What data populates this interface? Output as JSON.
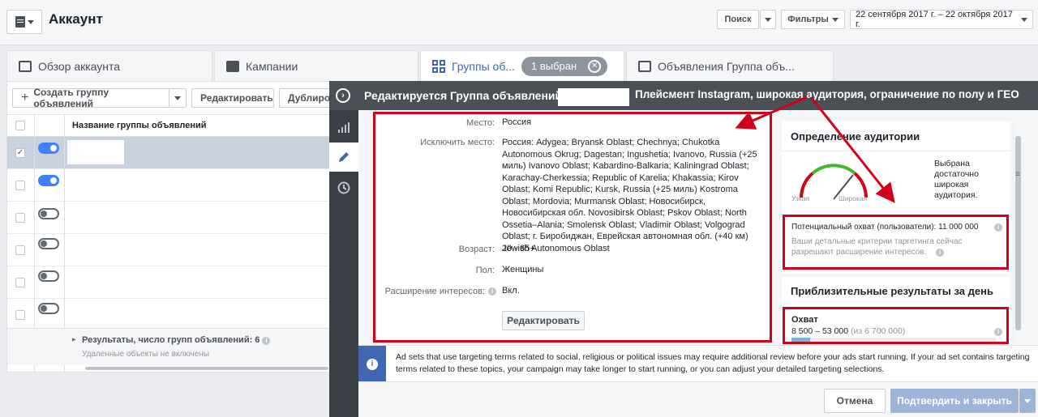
{
  "header": {
    "title": "Аккаунт",
    "search_label": "Поиск",
    "filters_label": "Фильтры",
    "date_range": "22 сентября 2017 г. – 22 октября 2017 г."
  },
  "tabs": [
    {
      "label": "Обзор аккаунта"
    },
    {
      "label": "Кампании"
    },
    {
      "label": "Группы об...",
      "pill": "1 выбран"
    },
    {
      "label": "Объявления Группа объ..."
    }
  ],
  "toolbar": {
    "create_label": "Создать группу объявлений",
    "edit_label": "Редактировать",
    "duplicate_label": "Дублиров"
  },
  "table": {
    "column_name": "Название группы объявлений",
    "footer_title": "Результаты, число групп объявлений: 6",
    "footer_sub": "Удаленные объекты не включены",
    "rows": [
      {
        "selected": true,
        "on": true
      },
      {
        "selected": false,
        "on": true
      },
      {
        "selected": false,
        "on": false
      },
      {
        "selected": false,
        "on": false
      },
      {
        "selected": false,
        "on": false
      },
      {
        "selected": false,
        "on": false
      }
    ]
  },
  "panel": {
    "title": "Редактируется Группа объявлений",
    "annotation": "Плейсмент Instagram, широкая аудитория, ограничение по полу и ГЕО"
  },
  "targeting": {
    "place_label": "Место:",
    "place_value": "Россия",
    "exclude_label": "Исключить место:",
    "exclude_value": "Россия: Adygea; Bryansk Oblast; Chechnya; Chukotka Autonomous Okrug; Dagestan; Ingushetia; Ivanovo, Russia (+25 миль) Ivanovo Oblast; Kabardino-Balkaria; Kaliningrad Oblast; Karachay-Cherkessia; Republic of Karelia; Khakassia; Kirov Oblast; Komi Republic; Kursk, Russia (+25 миль) Kostroma Oblast; Mordovia; Murmansk Oblast; Новосибирск, Новосибирская обл. Novosibirsk Oblast; Pskov Oblast; North Ossetia–Alania; Smolensk Oblast; Vladimir Oblast; Volgograd Oblast; г. Биробиджан, Еврейская автономная обл. (+40 км) Jewish Autonomous Oblast",
    "age_label": "Возраст:",
    "age_value": "20 - 65+",
    "gender_label": "Пол:",
    "gender_value": "Женщины",
    "expansion_label": "Расширение интересов:",
    "expansion_value": "Вкл.",
    "edit_button": "Редактировать"
  },
  "audience": {
    "title": "Определение аудитории",
    "gauge_narrow": "Узкая",
    "gauge_wide": "Широкая",
    "gauge_text": "Выбрана достаточно широкая аудитория.",
    "reach_label": "Потенциальный охват (пользователи): 11 000 000",
    "reach_note": "Ваши детальные критерии таргетинга сейчас разрешают расширение интересов.",
    "daily_title": "Приблизительные результаты за день",
    "daily_reach_label": "Охват",
    "daily_reach_value": "8 500 – 53 000",
    "daily_reach_total": "(из 6 700 000)",
    "daily_reach_fraction": 0.09
  },
  "info": {
    "text": "Ad sets that use targeting terms related to social, religious or political issues may require additional review before your ads start running. If your ad set contains targeting terms related to these topics, your campaign may take longer to start running, or you can adjust your detailed targeting selections."
  },
  "footer": {
    "cancel_label": "Отмена",
    "confirm_label": "Подтвердить и закрыть"
  },
  "colors": {
    "annotation_red": "#d0021b",
    "fb_blue": "#4267b2",
    "toggle_blue": "#4080ff"
  }
}
